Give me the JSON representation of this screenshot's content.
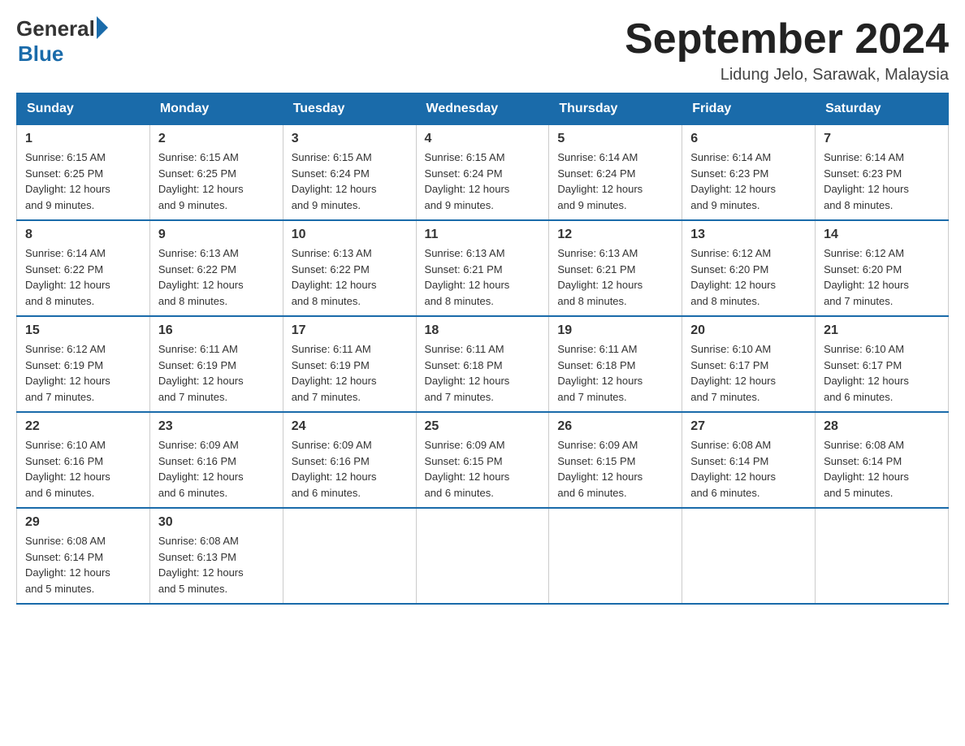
{
  "header": {
    "logo_general": "General",
    "logo_blue": "Blue",
    "main_title": "September 2024",
    "subtitle": "Lidung Jelo, Sarawak, Malaysia"
  },
  "weekdays": [
    "Sunday",
    "Monday",
    "Tuesday",
    "Wednesday",
    "Thursday",
    "Friday",
    "Saturday"
  ],
  "weeks": [
    [
      {
        "day": "1",
        "sunrise": "6:15 AM",
        "sunset": "6:25 PM",
        "daylight": "12 hours and 9 minutes."
      },
      {
        "day": "2",
        "sunrise": "6:15 AM",
        "sunset": "6:25 PM",
        "daylight": "12 hours and 9 minutes."
      },
      {
        "day": "3",
        "sunrise": "6:15 AM",
        "sunset": "6:24 PM",
        "daylight": "12 hours and 9 minutes."
      },
      {
        "day": "4",
        "sunrise": "6:15 AM",
        "sunset": "6:24 PM",
        "daylight": "12 hours and 9 minutes."
      },
      {
        "day": "5",
        "sunrise": "6:14 AM",
        "sunset": "6:24 PM",
        "daylight": "12 hours and 9 minutes."
      },
      {
        "day": "6",
        "sunrise": "6:14 AM",
        "sunset": "6:23 PM",
        "daylight": "12 hours and 9 minutes."
      },
      {
        "day": "7",
        "sunrise": "6:14 AM",
        "sunset": "6:23 PM",
        "daylight": "12 hours and 8 minutes."
      }
    ],
    [
      {
        "day": "8",
        "sunrise": "6:14 AM",
        "sunset": "6:22 PM",
        "daylight": "12 hours and 8 minutes."
      },
      {
        "day": "9",
        "sunrise": "6:13 AM",
        "sunset": "6:22 PM",
        "daylight": "12 hours and 8 minutes."
      },
      {
        "day": "10",
        "sunrise": "6:13 AM",
        "sunset": "6:22 PM",
        "daylight": "12 hours and 8 minutes."
      },
      {
        "day": "11",
        "sunrise": "6:13 AM",
        "sunset": "6:21 PM",
        "daylight": "12 hours and 8 minutes."
      },
      {
        "day": "12",
        "sunrise": "6:13 AM",
        "sunset": "6:21 PM",
        "daylight": "12 hours and 8 minutes."
      },
      {
        "day": "13",
        "sunrise": "6:12 AM",
        "sunset": "6:20 PM",
        "daylight": "12 hours and 8 minutes."
      },
      {
        "day": "14",
        "sunrise": "6:12 AM",
        "sunset": "6:20 PM",
        "daylight": "12 hours and 7 minutes."
      }
    ],
    [
      {
        "day": "15",
        "sunrise": "6:12 AM",
        "sunset": "6:19 PM",
        "daylight": "12 hours and 7 minutes."
      },
      {
        "day": "16",
        "sunrise": "6:11 AM",
        "sunset": "6:19 PM",
        "daylight": "12 hours and 7 minutes."
      },
      {
        "day": "17",
        "sunrise": "6:11 AM",
        "sunset": "6:19 PM",
        "daylight": "12 hours and 7 minutes."
      },
      {
        "day": "18",
        "sunrise": "6:11 AM",
        "sunset": "6:18 PM",
        "daylight": "12 hours and 7 minutes."
      },
      {
        "day": "19",
        "sunrise": "6:11 AM",
        "sunset": "6:18 PM",
        "daylight": "12 hours and 7 minutes."
      },
      {
        "day": "20",
        "sunrise": "6:10 AM",
        "sunset": "6:17 PM",
        "daylight": "12 hours and 7 minutes."
      },
      {
        "day": "21",
        "sunrise": "6:10 AM",
        "sunset": "6:17 PM",
        "daylight": "12 hours and 6 minutes."
      }
    ],
    [
      {
        "day": "22",
        "sunrise": "6:10 AM",
        "sunset": "6:16 PM",
        "daylight": "12 hours and 6 minutes."
      },
      {
        "day": "23",
        "sunrise": "6:09 AM",
        "sunset": "6:16 PM",
        "daylight": "12 hours and 6 minutes."
      },
      {
        "day": "24",
        "sunrise": "6:09 AM",
        "sunset": "6:16 PM",
        "daylight": "12 hours and 6 minutes."
      },
      {
        "day": "25",
        "sunrise": "6:09 AM",
        "sunset": "6:15 PM",
        "daylight": "12 hours and 6 minutes."
      },
      {
        "day": "26",
        "sunrise": "6:09 AM",
        "sunset": "6:15 PM",
        "daylight": "12 hours and 6 minutes."
      },
      {
        "day": "27",
        "sunrise": "6:08 AM",
        "sunset": "6:14 PM",
        "daylight": "12 hours and 6 minutes."
      },
      {
        "day": "28",
        "sunrise": "6:08 AM",
        "sunset": "6:14 PM",
        "daylight": "12 hours and 5 minutes."
      }
    ],
    [
      {
        "day": "29",
        "sunrise": "6:08 AM",
        "sunset": "6:14 PM",
        "daylight": "12 hours and 5 minutes."
      },
      {
        "day": "30",
        "sunrise": "6:08 AM",
        "sunset": "6:13 PM",
        "daylight": "12 hours and 5 minutes."
      },
      null,
      null,
      null,
      null,
      null
    ]
  ]
}
